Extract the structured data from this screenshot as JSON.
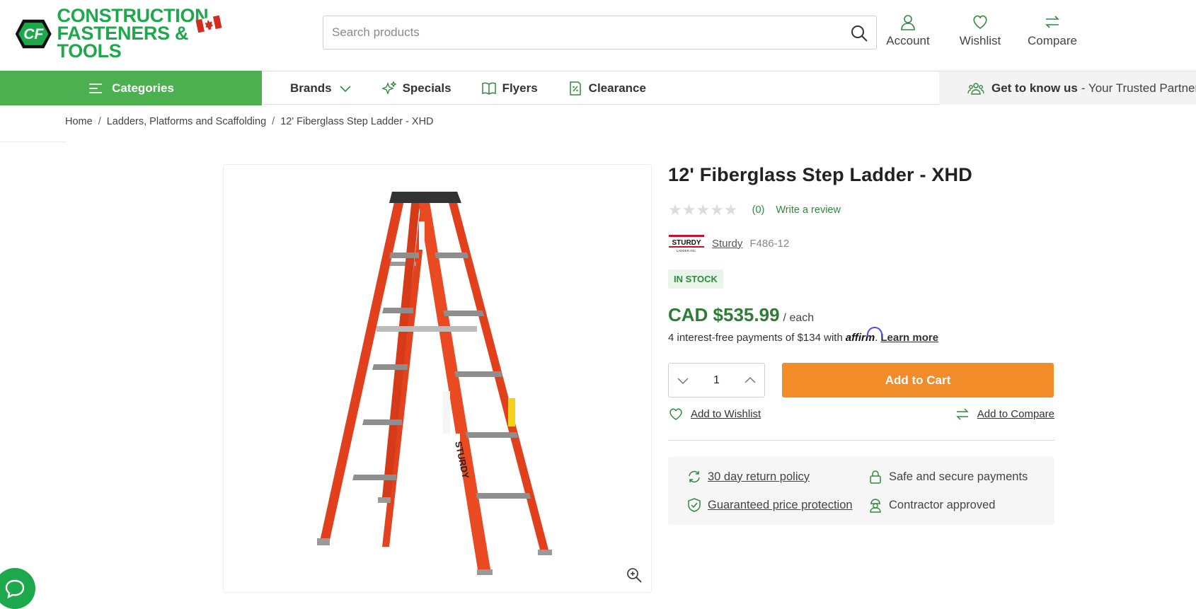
{
  "brand": {
    "line1": "CONSTRUCTION",
    "line2": "FASTENERS & TOOLS",
    "logo_mark": "CF"
  },
  "search": {
    "placeholder": "Search products"
  },
  "header_actions": [
    {
      "label": "Account",
      "icon": "user-icon"
    },
    {
      "label": "Wishlist",
      "icon": "heart-icon"
    },
    {
      "label": "Compare",
      "icon": "compare-arrows-icon"
    }
  ],
  "nav": {
    "categories": "Categories",
    "brands": "Brands",
    "specials": "Specials",
    "flyers": "Flyers",
    "clearance": "Clearance",
    "promo_bold": "Get to know us",
    "promo_rest": "- Your Trusted Partner in"
  },
  "breadcrumb": [
    "Home",
    "Ladders, Platforms and Scaffolding",
    "12' Fiberglass Step Ladder - XHD"
  ],
  "product": {
    "title": "12' Fiberglass Step Ladder - XHD",
    "rating_count": "(0)",
    "write_review": "Write a review",
    "brand_name": "Sturdy",
    "brand_logo_text": "STURDY",
    "brand_logo_sub": "LADDER INC.",
    "sku": "F486-12",
    "stock": "IN STOCK",
    "price": "CAD $535.99",
    "unit": "/ each",
    "affirm_text": "4 interest-free payments of $134 with",
    "affirm_brand": "affirm",
    "learn_more": "Learn more",
    "quantity": "1",
    "add_to_cart": "Add to Cart",
    "add_to_wishlist": "Add to Wishlist",
    "add_to_compare": "Add to Compare"
  },
  "assurances": {
    "returns": "30 day return policy",
    "secure": "Safe and secure payments",
    "price_protection": "Guaranteed price protection",
    "contractor": "Contractor approved"
  },
  "colors": {
    "brand_green": "#1ea84c",
    "nav_green": "#4caf50",
    "price_green": "#2f7d34",
    "cart_orange": "#f28c28"
  }
}
